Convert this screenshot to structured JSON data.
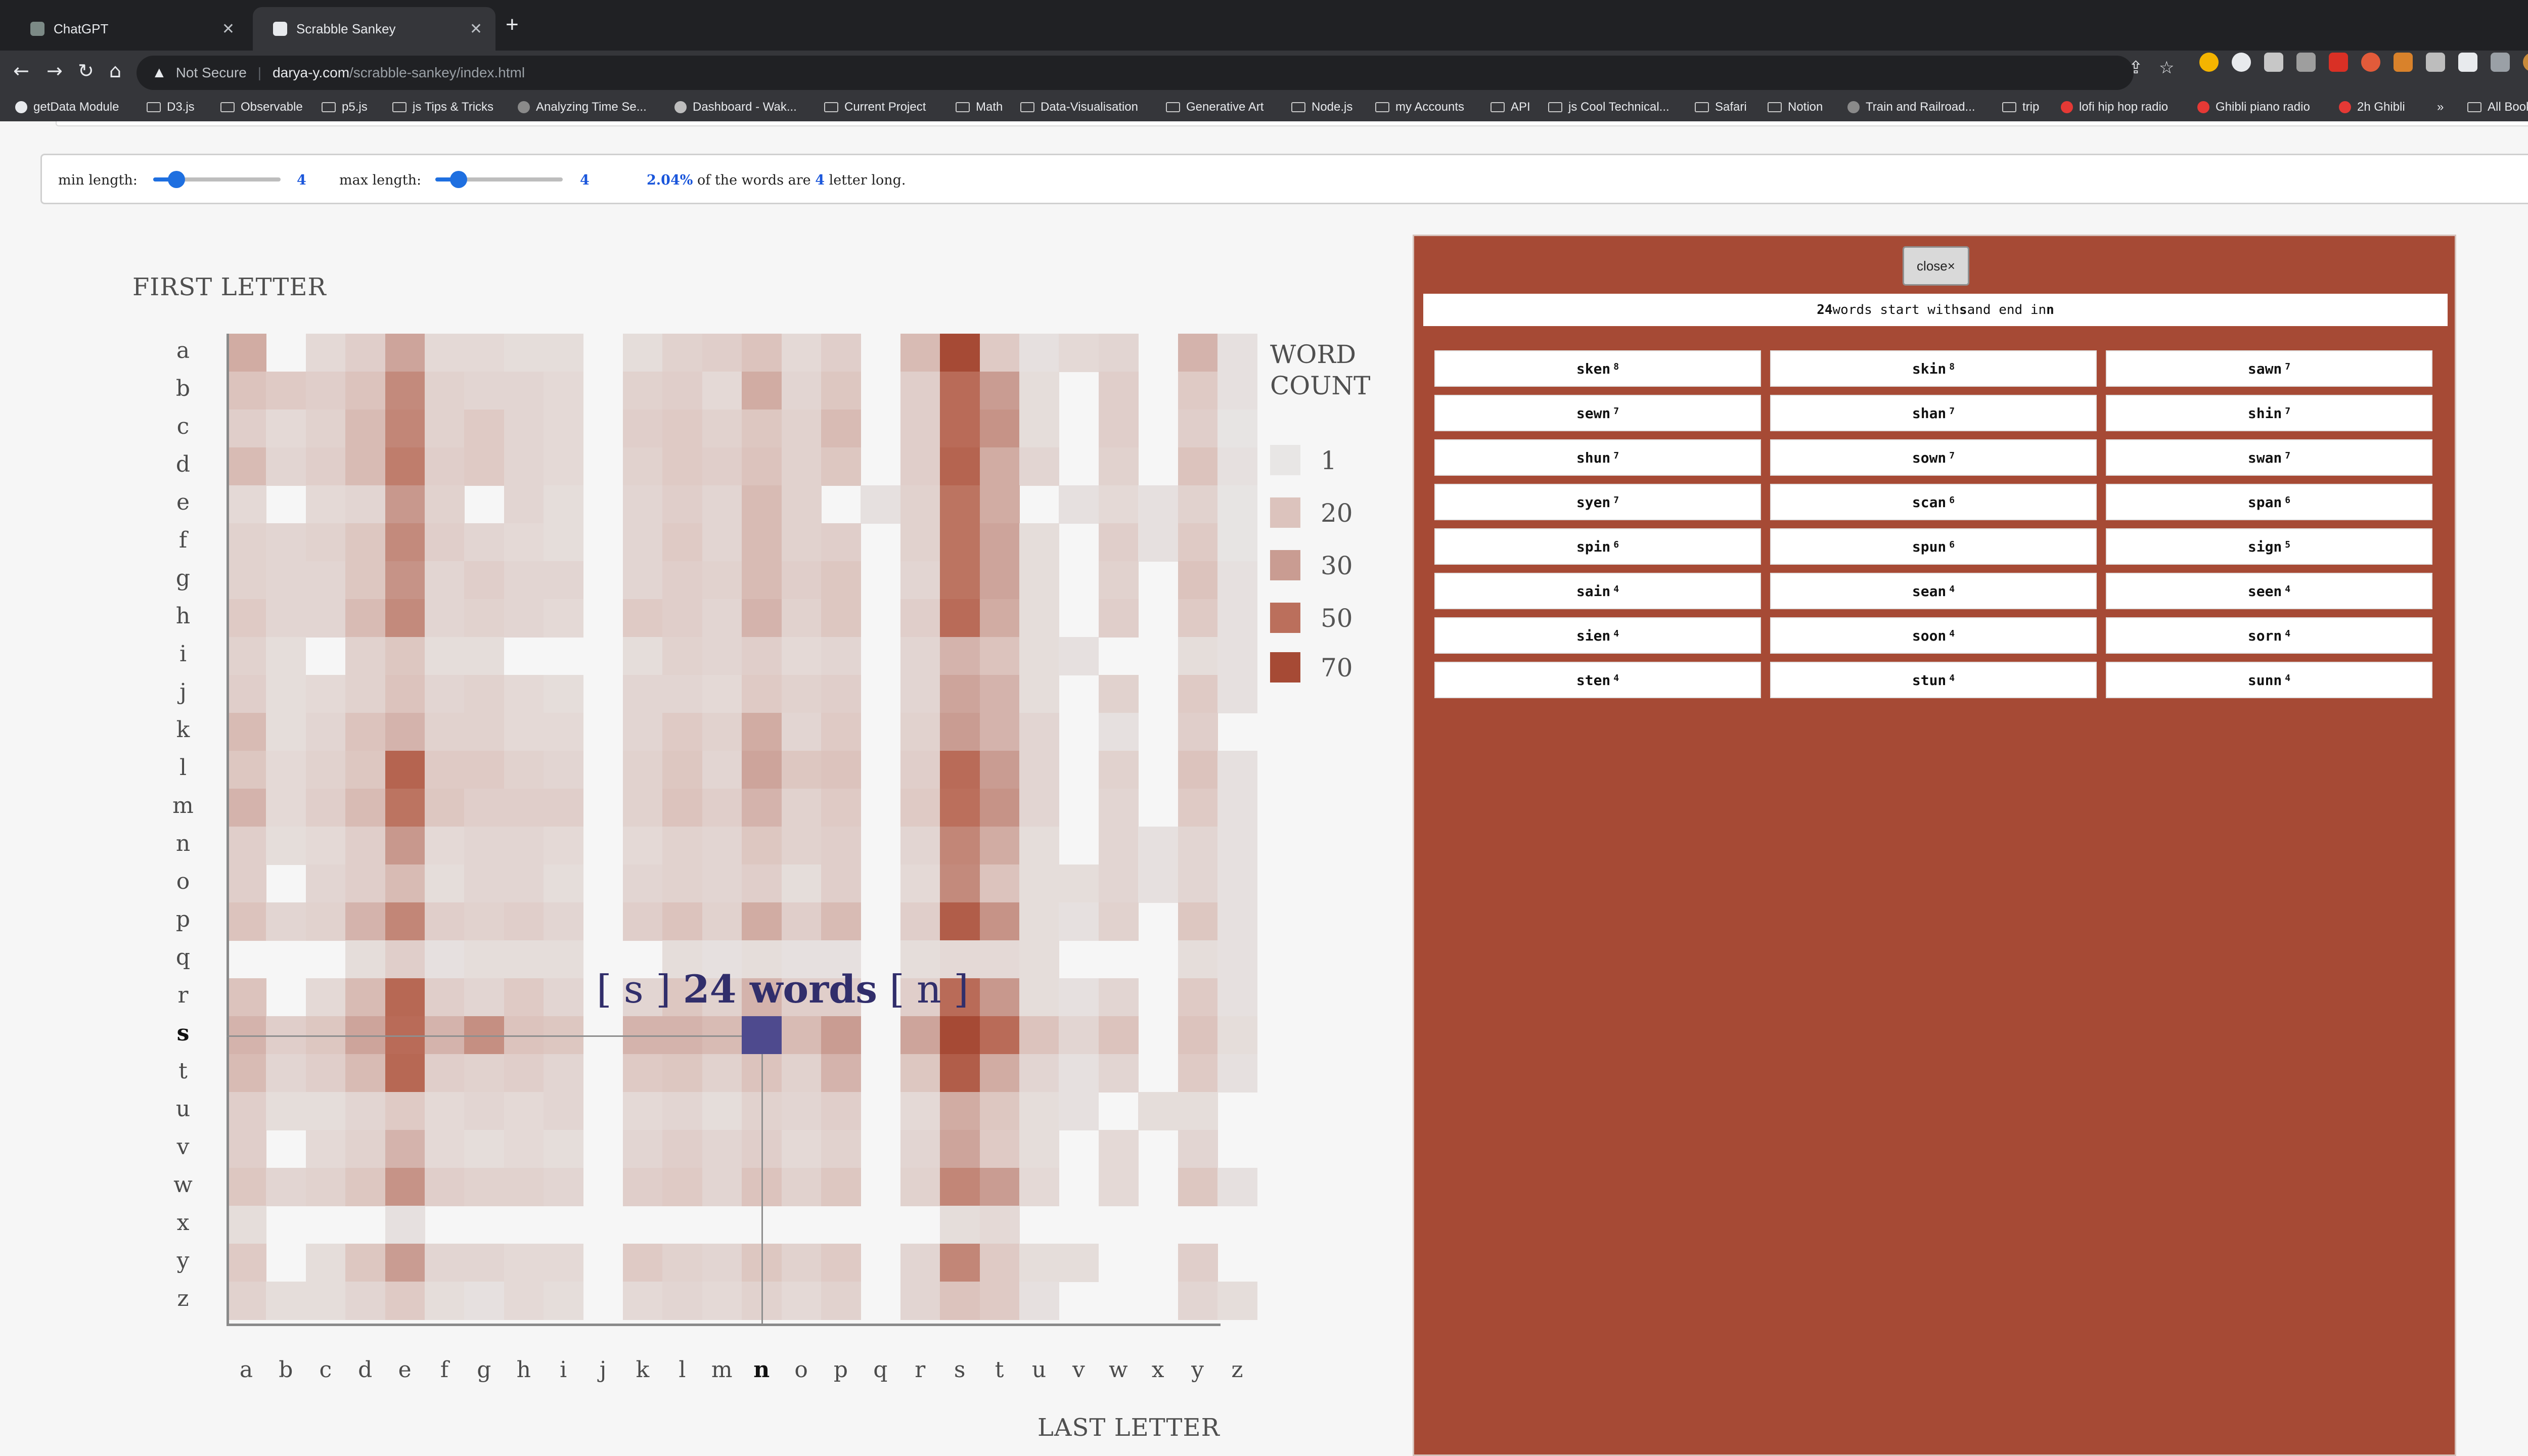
{
  "browser": {
    "tabs": [
      {
        "title": "ChatGPT",
        "active": false
      },
      {
        "title": "Scrabble Sankey",
        "active": true
      }
    ],
    "address": {
      "security": "Not Secure",
      "host": "darya-y.com",
      "path": "/scrabble-sankey/index.html"
    },
    "bookmarks": [
      "getData Module",
      "D3.js",
      "Observable",
      "p5.js",
      "js Tips & Tricks",
      "Analyzing Time Se...",
      "Dashboard - Wak...",
      "Current Project",
      "Math",
      "Data-Visualisation",
      "Generative Art",
      "Node.js",
      "my Accounts",
      "API",
      "js Cool Technical...",
      "Safari",
      "Notion",
      "Train and Railroad...",
      "trip",
      "lofi hip hop radio",
      "Ghibli piano radio",
      "2h Ghibli",
      "»",
      "All Bookmarks"
    ]
  },
  "controls": {
    "min_label": "min length:",
    "min_value": "4",
    "max_label": "max length:",
    "max_value": "4",
    "percent": "2.04%",
    "sentence_a": " of the words are ",
    "length_value": "4",
    "sentence_b": " letter long."
  },
  "chart_data": {
    "type": "heatmap",
    "y_title": "FIRST LETTER",
    "x_title": "LAST LETTER",
    "rows": [
      "a",
      "b",
      "c",
      "d",
      "e",
      "f",
      "g",
      "h",
      "i",
      "j",
      "k",
      "l",
      "m",
      "n",
      "o",
      "p",
      "q",
      "r",
      "s",
      "t",
      "u",
      "v",
      "w",
      "x",
      "y",
      "z"
    ],
    "cols": [
      "a",
      "b",
      "c",
      "d",
      "e",
      "f",
      "g",
      "h",
      "i",
      "j",
      "k",
      "l",
      "m",
      "n",
      "o",
      "p",
      "q",
      "r",
      "s",
      "t",
      "u",
      "v",
      "w",
      "x",
      "y",
      "z"
    ],
    "legend_title": [
      "WORD",
      "COUNT"
    ],
    "legend": [
      {
        "label": "1",
        "color": "#e8e6e5"
      },
      {
        "label": "20",
        "color": "#dcc3bd"
      },
      {
        "label": "30",
        "color": "#c99c92"
      },
      {
        "label": "50",
        "color": "#bb6f5c"
      },
      {
        "label": "70",
        "color": "#a64a35"
      }
    ],
    "selected": {
      "row": "s",
      "col": "n",
      "count": 24,
      "color": "#4e4a8e"
    },
    "hover_label": {
      "open": "[ s ] ",
      "count": "24 words",
      "close": " [ n ]"
    },
    "counts": [
      [
        26,
        0,
        8,
        14,
        28,
        8,
        8,
        6,
        6,
        0,
        6,
        12,
        14,
        20,
        8,
        14,
        0,
        22,
        70,
        16,
        4,
        8,
        10,
        0,
        24,
        4
      ],
      [
        20,
        16,
        14,
        20,
        38,
        12,
        10,
        10,
        8,
        0,
        12,
        14,
        8,
        26,
        10,
        18,
        0,
        14,
        52,
        30,
        6,
        0,
        14,
        0,
        16,
        4
      ],
      [
        14,
        8,
        12,
        22,
        40,
        12,
        16,
        10,
        8,
        0,
        14,
        16,
        12,
        18,
        12,
        22,
        0,
        14,
        52,
        34,
        6,
        0,
        14,
        0,
        14,
        2
      ],
      [
        22,
        10,
        14,
        22,
        44,
        14,
        16,
        10,
        8,
        0,
        12,
        16,
        14,
        20,
        12,
        18,
        0,
        14,
        56,
        26,
        10,
        0,
        12,
        0,
        20,
        4
      ],
      [
        8,
        0,
        8,
        10,
        32,
        12,
        0,
        10,
        6,
        0,
        10,
        14,
        10,
        22,
        12,
        0,
        4,
        12,
        48,
        26,
        0,
        4,
        8,
        4,
        12,
        2
      ],
      [
        12,
        10,
        12,
        18,
        38,
        14,
        10,
        8,
        6,
        0,
        10,
        16,
        10,
        22,
        12,
        14,
        0,
        12,
        48,
        28,
        6,
        0,
        14,
        4,
        16,
        2
      ],
      [
        12,
        10,
        10,
        18,
        34,
        10,
        14,
        10,
        10,
        0,
        10,
        14,
        12,
        22,
        14,
        18,
        0,
        10,
        48,
        28,
        6,
        0,
        12,
        0,
        20,
        4
      ],
      [
        16,
        10,
        10,
        22,
        38,
        10,
        12,
        10,
        8,
        0,
        16,
        14,
        10,
        24,
        12,
        18,
        0,
        14,
        52,
        26,
        6,
        0,
        14,
        0,
        16,
        4
      ],
      [
        12,
        6,
        0,
        12,
        18,
        6,
        6,
        0,
        0,
        0,
        6,
        12,
        10,
        14,
        8,
        10,
        0,
        10,
        24,
        20,
        6,
        4,
        0,
        0,
        6,
        4
      ],
      [
        14,
        6,
        8,
        12,
        20,
        10,
        12,
        8,
        6,
        0,
        10,
        10,
        8,
        16,
        12,
        14,
        0,
        10,
        28,
        24,
        6,
        0,
        12,
        0,
        16,
        4
      ],
      [
        22,
        6,
        10,
        20,
        24,
        12,
        12,
        8,
        8,
        0,
        10,
        16,
        12,
        26,
        10,
        16,
        0,
        12,
        30,
        24,
        10,
        0,
        4,
        0,
        14,
        0
      ],
      [
        18,
        8,
        12,
        18,
        56,
        16,
        16,
        12,
        10,
        0,
        12,
        18,
        10,
        28,
        18,
        20,
        0,
        14,
        52,
        30,
        10,
        0,
        12,
        0,
        20,
        4
      ],
      [
        24,
        8,
        14,
        22,
        48,
        18,
        14,
        14,
        14,
        0,
        12,
        20,
        14,
        24,
        12,
        16,
        0,
        16,
        50,
        34,
        10,
        0,
        10,
        0,
        16,
        4
      ],
      [
        14,
        6,
        8,
        14,
        32,
        8,
        10,
        10,
        8,
        0,
        8,
        12,
        10,
        18,
        12,
        14,
        0,
        10,
        40,
        26,
        6,
        0,
        10,
        4,
        10,
        4
      ],
      [
        14,
        0,
        10,
        14,
        22,
        6,
        10,
        10,
        6,
        0,
        10,
        12,
        10,
        14,
        6,
        14,
        0,
        8,
        38,
        20,
        6,
        6,
        10,
        4,
        10,
        4
      ],
      [
        20,
        10,
        12,
        24,
        40,
        14,
        12,
        14,
        10,
        0,
        14,
        20,
        12,
        26,
        14,
        22,
        0,
        14,
        60,
        34,
        6,
        4,
        12,
        0,
        18,
        4
      ],
      [
        0,
        0,
        0,
        6,
        14,
        4,
        6,
        6,
        6,
        0,
        0,
        6,
        4,
        6,
        4,
        4,
        0,
        6,
        8,
        8,
        6,
        0,
        0,
        0,
        6,
        4
      ],
      [
        20,
        0,
        8,
        22,
        54,
        14,
        10,
        16,
        10,
        0,
        10,
        18,
        12,
        24,
        14,
        14,
        0,
        14,
        52,
        32,
        6,
        4,
        10,
        0,
        16,
        4
      ],
      [
        24,
        14,
        18,
        28,
        52,
        24,
        36,
        20,
        18,
        0,
        24,
        24,
        22,
        24,
        22,
        30,
        0,
        28,
        70,
        52,
        20,
        10,
        20,
        0,
        20,
        6
      ],
      [
        22,
        10,
        14,
        22,
        54,
        14,
        12,
        14,
        10,
        0,
        16,
        18,
        12,
        20,
        12,
        24,
        0,
        18,
        60,
        26,
        10,
        4,
        10,
        0,
        16,
        4
      ],
      [
        14,
        6,
        6,
        10,
        16,
        8,
        10,
        8,
        10,
        0,
        8,
        10,
        6,
        12,
        10,
        14,
        0,
        8,
        26,
        18,
        6,
        4,
        0,
        6,
        6,
        0
      ],
      [
        14,
        0,
        8,
        12,
        24,
        8,
        6,
        8,
        6,
        0,
        10,
        14,
        10,
        14,
        8,
        12,
        0,
        10,
        28,
        16,
        6,
        0,
        8,
        0,
        10,
        0
      ],
      [
        18,
        10,
        12,
        18,
        34,
        14,
        12,
        12,
        10,
        0,
        14,
        16,
        10,
        20,
        12,
        18,
        0,
        12,
        40,
        30,
        8,
        0,
        8,
        0,
        18,
        4
      ],
      [
        6,
        0,
        0,
        0,
        4,
        0,
        0,
        0,
        0,
        0,
        0,
        0,
        0,
        0,
        0,
        0,
        0,
        0,
        6,
        8,
        0,
        0,
        0,
        0,
        0,
        0
      ],
      [
        16,
        0,
        6,
        18,
        30,
        10,
        10,
        8,
        8,
        0,
        16,
        12,
        10,
        18,
        12,
        16,
        0,
        10,
        40,
        16,
        6,
        6,
        0,
        0,
        14,
        0
      ],
      [
        12,
        6,
        6,
        10,
        16,
        6,
        4,
        8,
        6,
        0,
        8,
        10,
        8,
        12,
        8,
        12,
        0,
        10,
        20,
        16,
        4,
        0,
        0,
        0,
        10,
        6
      ]
    ]
  },
  "panel": {
    "close_label": "close×",
    "summary": {
      "count": "24",
      "a": " words start with ",
      "start": "s",
      "b": " and end in ",
      "end": "n"
    },
    "words": [
      {
        "w": "sken",
        "s": "8"
      },
      {
        "w": "skin",
        "s": "8"
      },
      {
        "w": "sawn",
        "s": "7"
      },
      {
        "w": "sewn",
        "s": "7"
      },
      {
        "w": "shan",
        "s": "7"
      },
      {
        "w": "shin",
        "s": "7"
      },
      {
        "w": "shun",
        "s": "7"
      },
      {
        "w": "sown",
        "s": "7"
      },
      {
        "w": "swan",
        "s": "7"
      },
      {
        "w": "syen",
        "s": "7"
      },
      {
        "w": "scan",
        "s": "6"
      },
      {
        "w": "span",
        "s": "6"
      },
      {
        "w": "spin",
        "s": "6"
      },
      {
        "w": "spun",
        "s": "6"
      },
      {
        "w": "sign",
        "s": "5"
      },
      {
        "w": "sain",
        "s": "4"
      },
      {
        "w": "sean",
        "s": "4"
      },
      {
        "w": "seen",
        "s": "4"
      },
      {
        "w": "sien",
        "s": "4"
      },
      {
        "w": "soon",
        "s": "4"
      },
      {
        "w": "sorn",
        "s": "4"
      },
      {
        "w": "sten",
        "s": "4"
      },
      {
        "w": "stun",
        "s": "4"
      },
      {
        "w": "sunn",
        "s": "4"
      }
    ]
  }
}
